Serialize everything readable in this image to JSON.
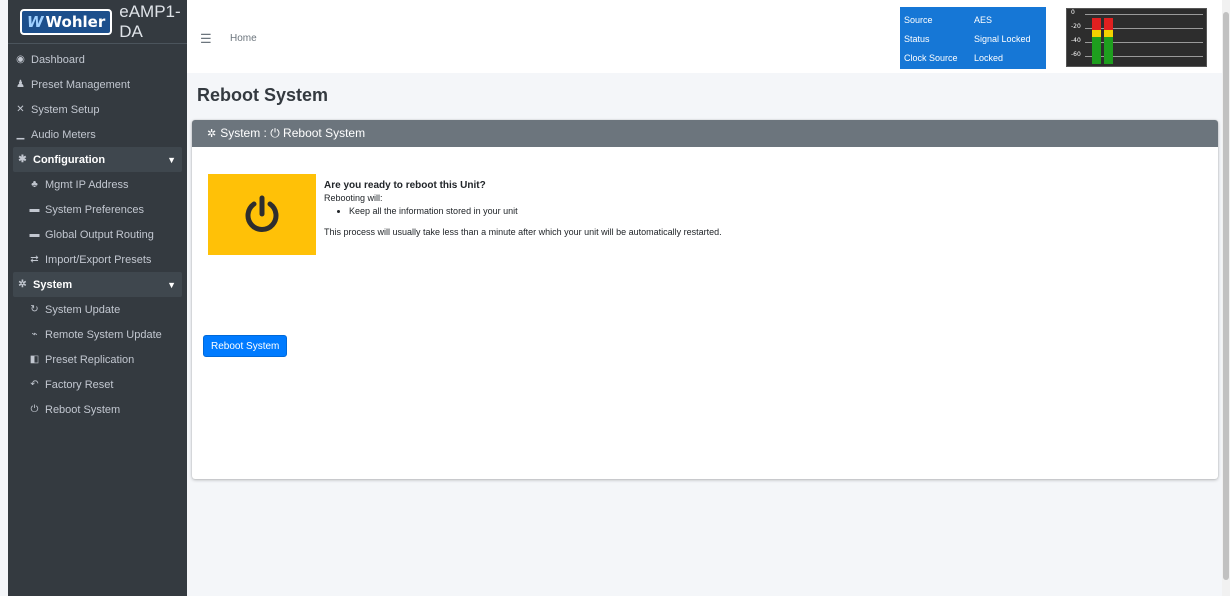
{
  "brand": {
    "logo": "Wohler",
    "title": "eAMP1-DA"
  },
  "sidebar": {
    "items": [
      {
        "label": "Dashboard",
        "icon": "dashboard-icon",
        "glyph": "◉"
      },
      {
        "label": "Preset Management",
        "icon": "user-cog-icon",
        "glyph": "♟"
      },
      {
        "label": "System Setup",
        "icon": "tools-icon",
        "glyph": "✕"
      },
      {
        "label": "Audio Meters",
        "icon": "chart-icon",
        "glyph": "▁"
      }
    ],
    "config_group": {
      "label": "Configuration",
      "icon": "gear-icon",
      "glyph": "✱"
    },
    "config_items": [
      {
        "label": "Mgmt IP Address",
        "icon": "network-icon",
        "glyph": "♣"
      },
      {
        "label": "System Preferences",
        "icon": "keyboard-icon",
        "glyph": "▬"
      },
      {
        "label": "Global Output Routing",
        "icon": "routing-icon",
        "glyph": "▬"
      },
      {
        "label": "Import/Export Presets",
        "icon": "exchange-icon",
        "glyph": "⇄"
      }
    ],
    "system_group": {
      "label": "System",
      "icon": "gears-icon",
      "glyph": "✲"
    },
    "system_items": [
      {
        "label": "System Update",
        "icon": "sync-icon",
        "glyph": "↻"
      },
      {
        "label": "Remote System Update",
        "icon": "satellite-icon",
        "glyph": "⌁"
      },
      {
        "label": "Preset Replication",
        "icon": "copy-icon",
        "glyph": "◧"
      },
      {
        "label": "Factory Reset",
        "icon": "undo-icon",
        "glyph": "↶"
      },
      {
        "label": "Reboot System",
        "icon": "power-icon",
        "glyph": "⏻"
      }
    ]
  },
  "header": {
    "breadcrumb": "Home",
    "status": [
      {
        "key": "Source",
        "value": "AES"
      },
      {
        "key": "Status",
        "value": "Signal Locked"
      },
      {
        "key": "Clock Source",
        "value": "Locked"
      }
    ],
    "meter_ticks": [
      "0",
      "-20",
      "-40",
      "-60"
    ]
  },
  "main": {
    "title": "Reboot System",
    "card_header": "System : ⏻ Reboot System",
    "question": "Are you ready to reboot this Unit?",
    "subheading": "Rebooting will:",
    "bullets": [
      "Keep all the information stored in your unit"
    ],
    "note": "This process will usually take less than a minute after which your unit will be automatically restarted.",
    "button_label": "Reboot System"
  },
  "colors": {
    "sidebar": "#343a40",
    "status_box": "#1677d6",
    "tile": "#ffc107",
    "button": "#007bff",
    "card_header": "#6c757d"
  }
}
